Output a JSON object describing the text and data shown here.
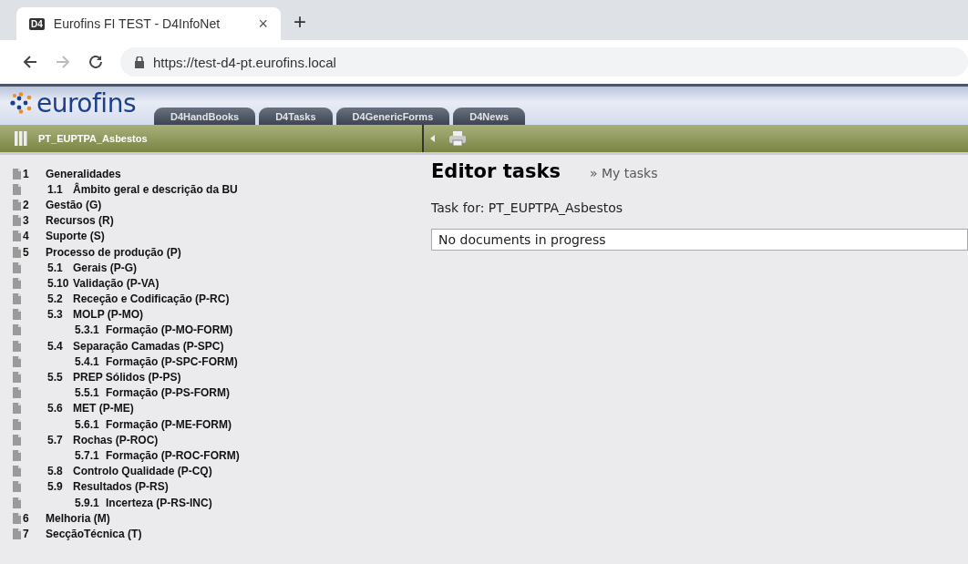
{
  "browser": {
    "tab_title": "Eurofins FI TEST - D4InfoNet",
    "tab_favicon": "D4",
    "close": "×",
    "new_tab": "+",
    "url": "https://test-d4-pt.eurofins.local"
  },
  "header": {
    "logo": "eurofins",
    "tabs": [
      {
        "label": "D4HandBooks",
        "selected": false
      },
      {
        "label": "D4Tasks",
        "selected": false
      },
      {
        "label": "D4GenericForms",
        "selected": false
      },
      {
        "label": "D4News",
        "selected": false
      }
    ]
  },
  "toolbar": {
    "title": "PT_EUPTPA_Asbestos"
  },
  "tree": [
    {
      "number": "1",
      "label": "Generalidades",
      "children": [
        {
          "number": "1.1",
          "label": "Âmbito geral e descrição da BU"
        }
      ]
    },
    {
      "number": "2",
      "label": "Gestão (G)"
    },
    {
      "number": "3",
      "label": "Recursos (R)"
    },
    {
      "number": "4",
      "label": "Suporte (S)"
    },
    {
      "number": "5",
      "label": "Processo de produção (P)",
      "children": [
        {
          "number": "5.1",
          "label": "Gerais (P-G)"
        },
        {
          "number": "5.10",
          "label": "Validação (P-VA)"
        },
        {
          "number": "5.2",
          "label": "Receção e Codificação (P-RC)"
        },
        {
          "number": "5.3",
          "label": "MOLP (P-MO)",
          "children": [
            {
              "number": "5.3.1",
              "label": "Formação (P-MO-FORM)"
            }
          ]
        },
        {
          "number": "5.4",
          "label": "Separação Camadas (P-SPC)",
          "children": [
            {
              "number": "5.4.1",
              "label": "Formação (P-SPC-FORM)"
            }
          ]
        },
        {
          "number": "5.5",
          "label": "PREP Sólidos (P-PS)",
          "children": [
            {
              "number": "5.5.1",
              "label": "Formação (P-PS-FORM)"
            }
          ]
        },
        {
          "number": "5.6",
          "label": "MET (P-ME)",
          "children": [
            {
              "number": "5.6.1",
              "label": "Formação (P-ME-FORM)"
            }
          ]
        },
        {
          "number": "5.7",
          "label": "Rochas (P-ROC)",
          "children": [
            {
              "number": "5.7.1",
              "label": "Formação (P-ROC-FORM)"
            }
          ]
        },
        {
          "number": "5.8",
          "label": "Controlo Qualidade (P-CQ)"
        },
        {
          "number": "5.9",
          "label": "Resultados (P-RS)",
          "children": [
            {
              "number": "5.9.1",
              "label": "Incerteza (P-RS-INC)"
            }
          ]
        }
      ]
    },
    {
      "number": "6",
      "label": "Melhoria (M)"
    },
    {
      "number": "7",
      "label": "SecçãoTécnica (T)"
    }
  ],
  "main": {
    "title": "Editor tasks",
    "link": "» My tasks",
    "task_for": "Task for: PT_EUPTPA_Asbestos",
    "status": "No documents in progress"
  }
}
